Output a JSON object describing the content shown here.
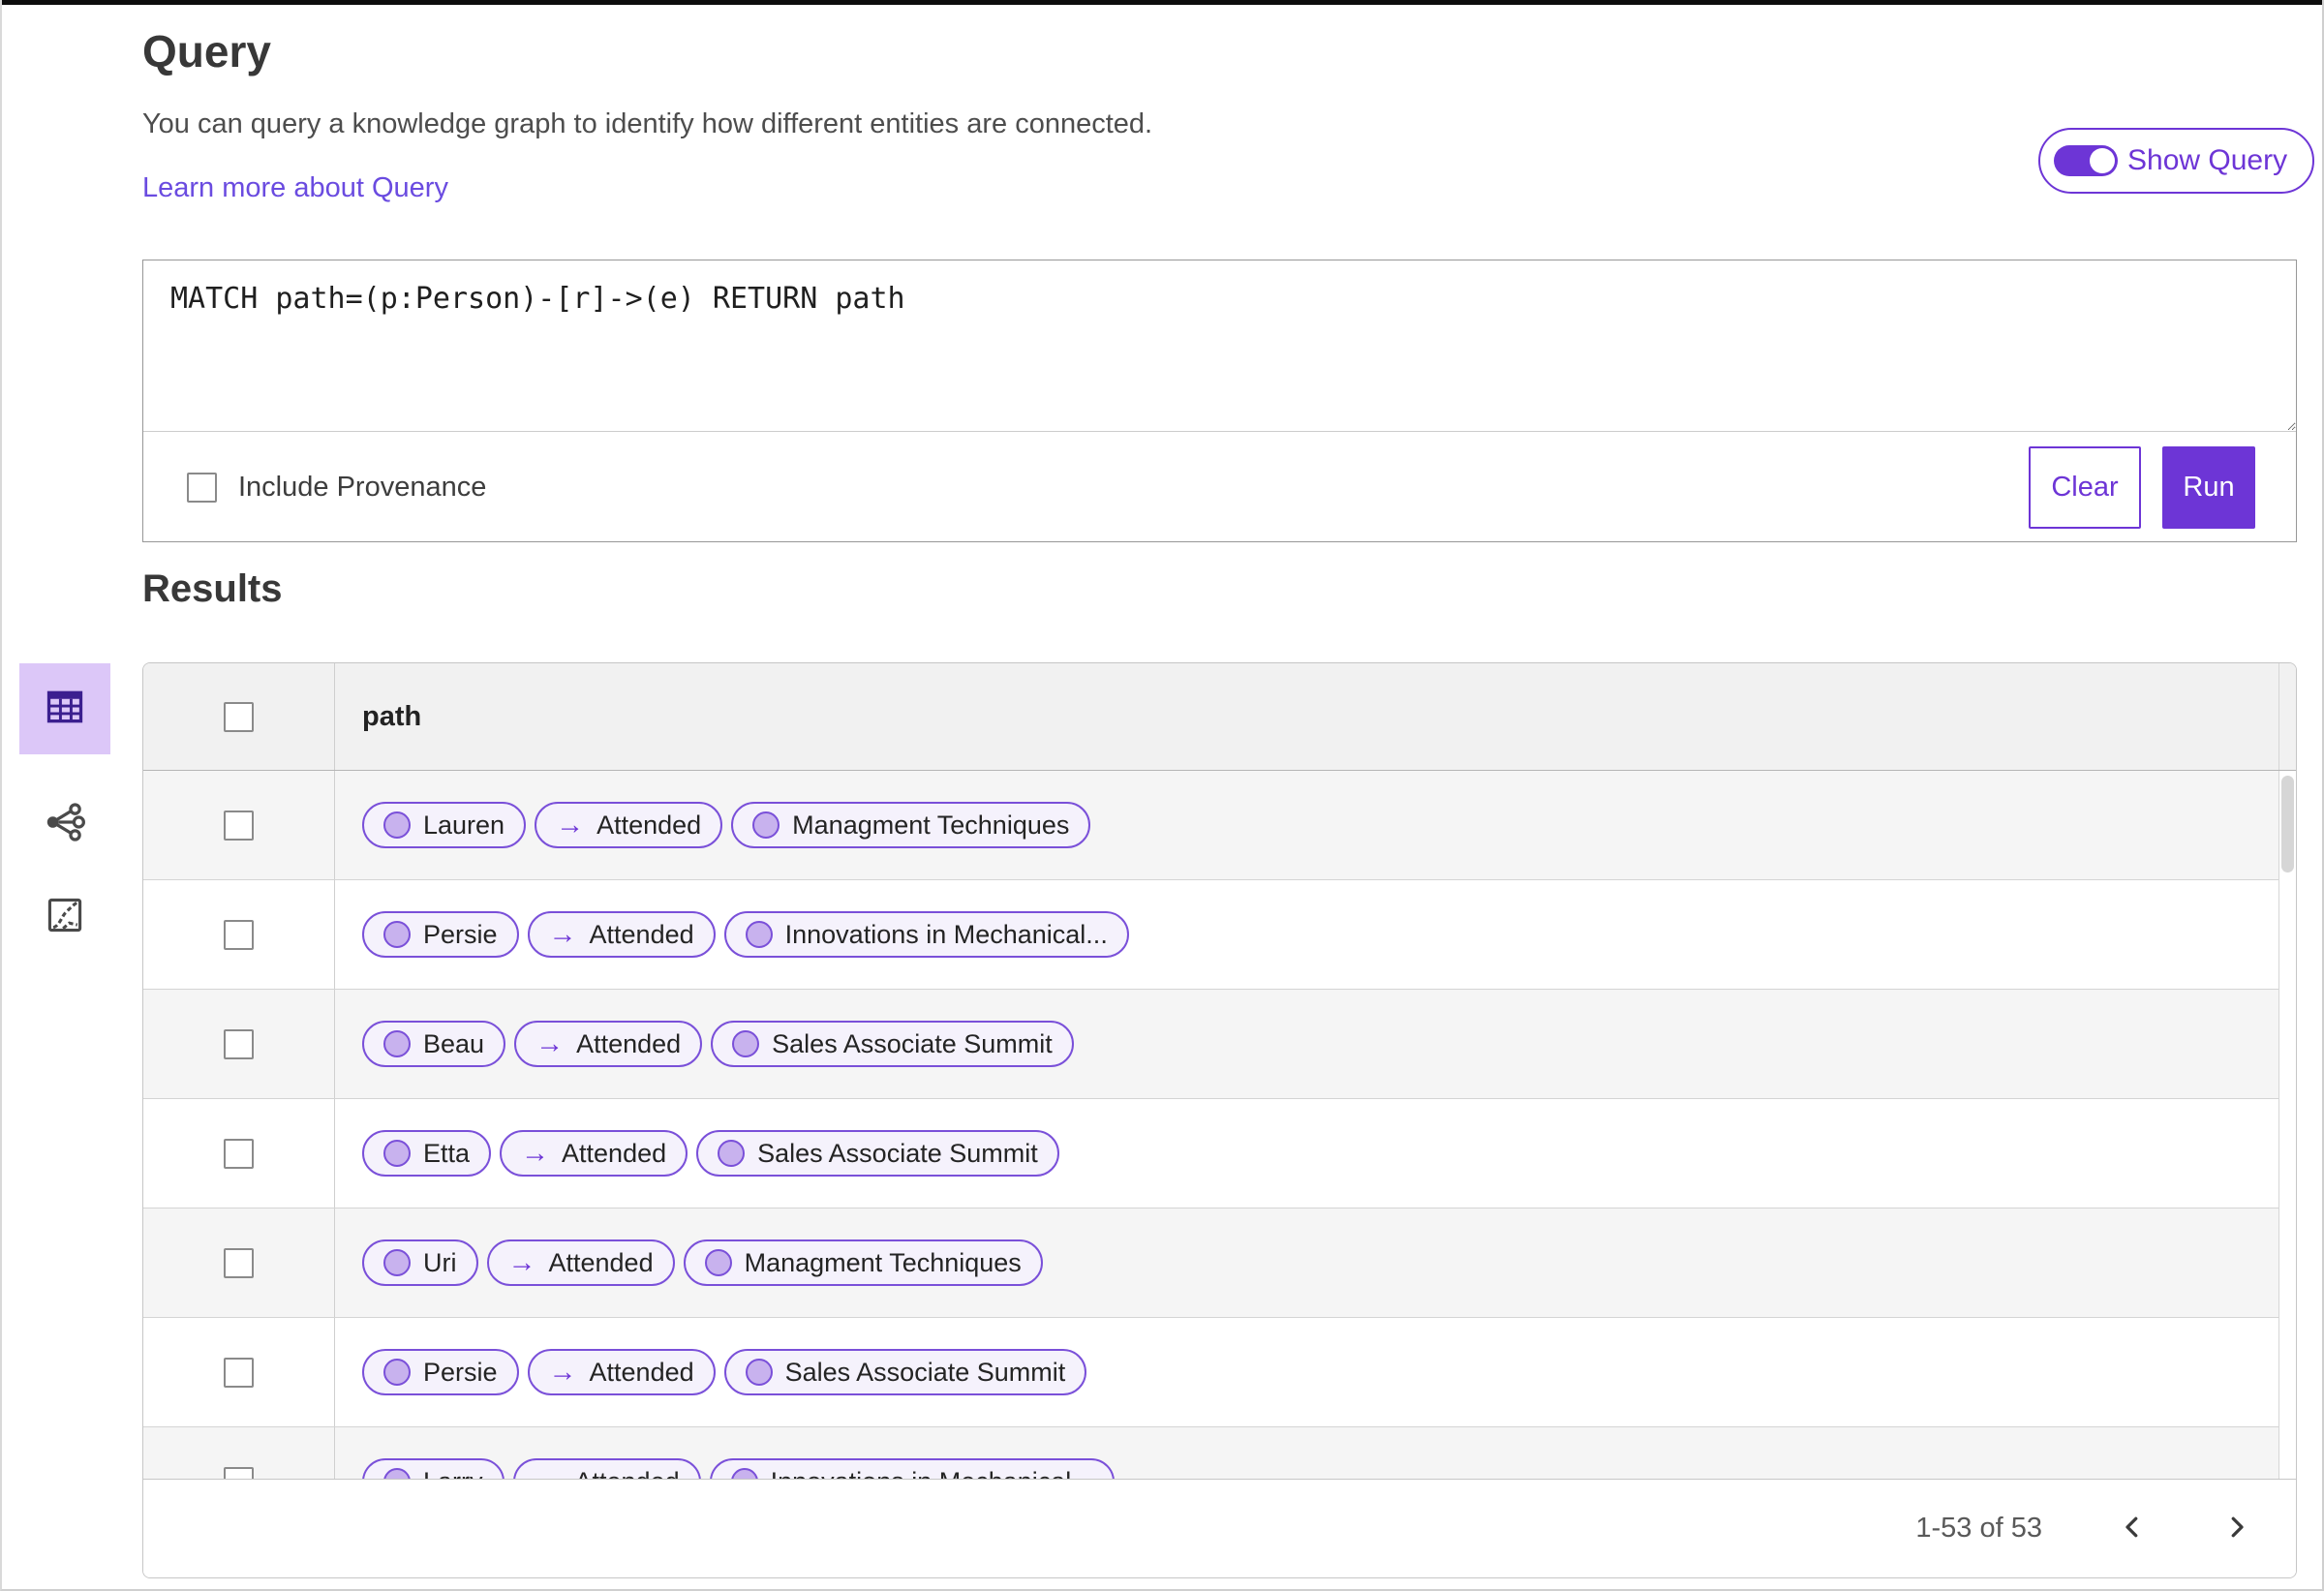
{
  "page": {
    "title": "Query",
    "description": "You can query a knowledge graph to identify how different entities are connected.",
    "learn_more_label": "Learn more about Query"
  },
  "show_query_toggle": {
    "label": "Show Query",
    "state": "on"
  },
  "query_editor": {
    "text": "MATCH path=(p:Person)-[r]->(e) RETURN path",
    "include_provenance_label": "Include Provenance",
    "include_provenance_checked": false,
    "clear_label": "Clear",
    "run_label": "Run"
  },
  "results": {
    "title": "Results",
    "column_header": "path",
    "views": [
      {
        "icon": "table-view-icon",
        "selected": true
      },
      {
        "icon": "graph-view-icon",
        "selected": false
      },
      {
        "icon": "chart-view-icon",
        "selected": false
      }
    ],
    "rows": [
      {
        "source": "Lauren",
        "relation": "Attended",
        "target": "Managment Techniques"
      },
      {
        "source": "Persie",
        "relation": "Attended",
        "target": "Innovations in Mechanical..."
      },
      {
        "source": "Beau",
        "relation": "Attended",
        "target": "Sales Associate Summit"
      },
      {
        "source": "Etta",
        "relation": "Attended",
        "target": "Sales Associate Summit"
      },
      {
        "source": "Uri",
        "relation": "Attended",
        "target": "Managment Techniques"
      },
      {
        "source": "Persie",
        "relation": "Attended",
        "target": "Sales Associate Summit"
      },
      {
        "source": "Larry",
        "relation": "Attended",
        "target": "Innovations in Mechanical..."
      }
    ],
    "edge_arrow": "→",
    "pagination": {
      "label": "1-53 of 53"
    }
  },
  "colors": {
    "accent": "#6d35d6",
    "pill_border": "#7a50d9",
    "pill_background": "#f5f2fc",
    "node_fill": "#c8b2ee",
    "selected_view_background": "#dcc7f8",
    "link": "#6a4be0"
  }
}
